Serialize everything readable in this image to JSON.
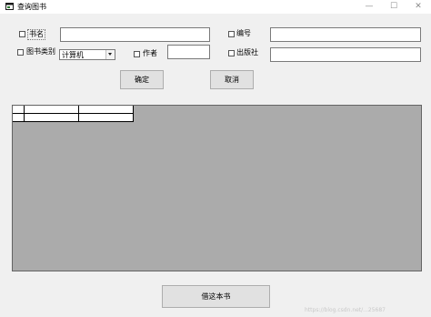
{
  "window": {
    "title": "查询图书",
    "minimize_glyph": "—",
    "maximize_glyph": "☐",
    "close_glyph": "✕"
  },
  "form": {
    "book_name_label": "书名",
    "book_name_value": "",
    "number_label": "编号",
    "number_value": "",
    "category_label": "图书类别",
    "category_selected": "计算机",
    "author_label": "作者",
    "author_value": "",
    "publisher_label": "出版社",
    "publisher_value": ""
  },
  "buttons": {
    "confirm": "确定",
    "cancel": "取消",
    "borrow": "借这本书"
  },
  "grid": {
    "columns": [
      "",
      ""
    ],
    "rows": []
  },
  "watermark": "https://blog.csdn.net/...25687"
}
